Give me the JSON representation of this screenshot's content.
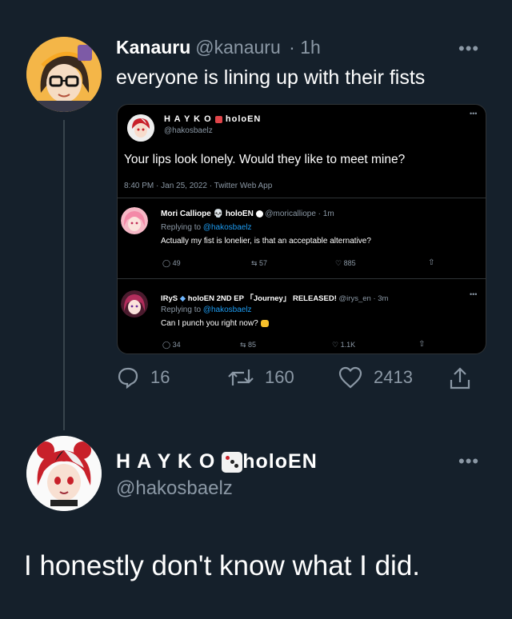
{
  "tweet": {
    "author_name": "Kanauru",
    "author_handle": "@kanauru",
    "time": "· 1h",
    "text": "everyone is lining up with their fists",
    "more": "•••",
    "stats": {
      "replies": "16",
      "retweets": "160",
      "likes": "2413"
    }
  },
  "embed": {
    "author_name": "H A Y K O",
    "author_suffix": "holoEN",
    "author_handle": "@hakosbaelz",
    "text": "Your lips look lonely. Would they like to meet mine?",
    "meta": "8:40 PM · Jan 25, 2022 · Twitter Web App",
    "more": "•••",
    "replies": [
      {
        "name": "Mori Calliope",
        "suffix": "holoEN",
        "handle": "@moricalliope · 1m",
        "replying_label": "Replying to",
        "replying_to": "@hakosbaelz",
        "text": "Actually my fist is lonelier, is that an acceptable alternative?",
        "stats": {
          "replies": "49",
          "retweets": "57",
          "likes": "885"
        }
      },
      {
        "name": "IRyS",
        "suffix": "holoEN 2ND EP 「Journey」 RELEASED!",
        "handle": "@irys_en · 3m",
        "replying_label": "Replying to",
        "replying_to": "@hakosbaelz",
        "text": "Can I punch you right now?",
        "stats": {
          "replies": "34",
          "retweets": "85",
          "likes": "1.1K"
        }
      }
    ]
  },
  "reply": {
    "author_name": "H A Y K O",
    "author_suffix": "holoEN",
    "author_handle": "@hakosbaelz",
    "more": "•••",
    "text": "I honestly don't know what I did."
  },
  "colors": {
    "background": "#15202b",
    "muted": "#8b98a5",
    "link": "#1d9bf0",
    "divider": "#38444d"
  }
}
